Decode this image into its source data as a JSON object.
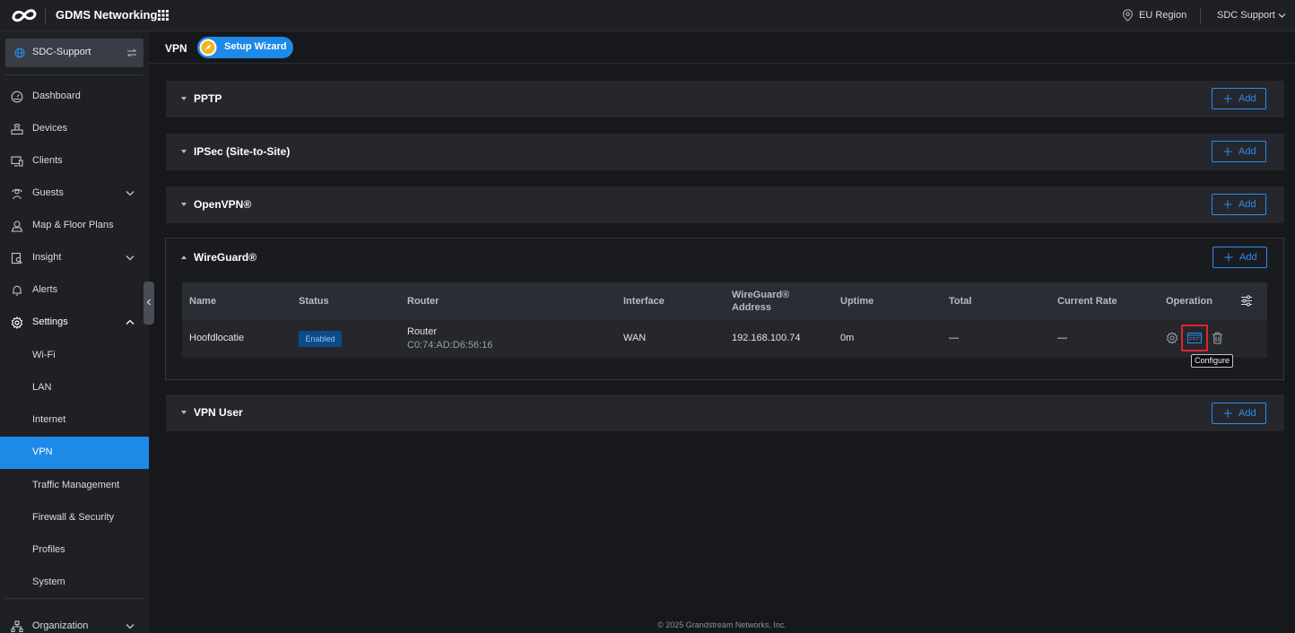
{
  "topbar": {
    "brand": "GDMS Networking",
    "region": "EU Region",
    "account": "SDC Support"
  },
  "sidebar": {
    "site": "SDC-Support",
    "items": [
      {
        "label": "Dashboard",
        "icon": "dashboard-icon"
      },
      {
        "label": "Devices",
        "icon": "devices-icon"
      },
      {
        "label": "Clients",
        "icon": "clients-icon"
      },
      {
        "label": "Guests",
        "icon": "guests-icon"
      },
      {
        "label": "Map & Floor Plans",
        "icon": "map-icon"
      },
      {
        "label": "Insight",
        "icon": "insight-icon"
      },
      {
        "label": "Alerts",
        "icon": "bell-icon"
      },
      {
        "label": "Settings",
        "icon": "gear-icon"
      }
    ],
    "settings_sub": [
      "Wi-Fi",
      "LAN",
      "Internet",
      "VPN",
      "Traffic Management",
      "Firewall & Security",
      "Profiles",
      "System"
    ],
    "organization": "Organization",
    "active": "VPN"
  },
  "page": {
    "title": "VPN",
    "wizard_label": "Setup Wizard"
  },
  "sections": {
    "pptp": "PPTP",
    "ipsec": "IPSec (Site-to-Site)",
    "openvpn": "OpenVPN®",
    "wireguard": "WireGuard®",
    "vpn_user": "VPN User",
    "add_label": "Add"
  },
  "wg_table": {
    "columns": {
      "name": "Name",
      "status": "Status",
      "router": "Router",
      "interface": "Interface",
      "address_line1": "WireGuard®",
      "address_line2": "Address",
      "uptime": "Uptime",
      "total": "Total",
      "current_rate": "Current Rate",
      "operation": "Operation"
    },
    "rows": [
      {
        "name": "Hoofdlocatie",
        "status": "Enabled",
        "router_name": "Router",
        "router_mac": "C0:74:AD:D6:56:16",
        "interface": "WAN",
        "address": "192.168.100.74",
        "uptime": "0m",
        "total": "—",
        "current_rate": "—"
      }
    ]
  },
  "tooltip": "Configure",
  "footer": "© 2025 Grandstream Networks, Inc.",
  "colors": {
    "accent": "#1e8ae8",
    "highlight": "#e3242b",
    "background": "#17181c",
    "panel": "#25272d"
  }
}
